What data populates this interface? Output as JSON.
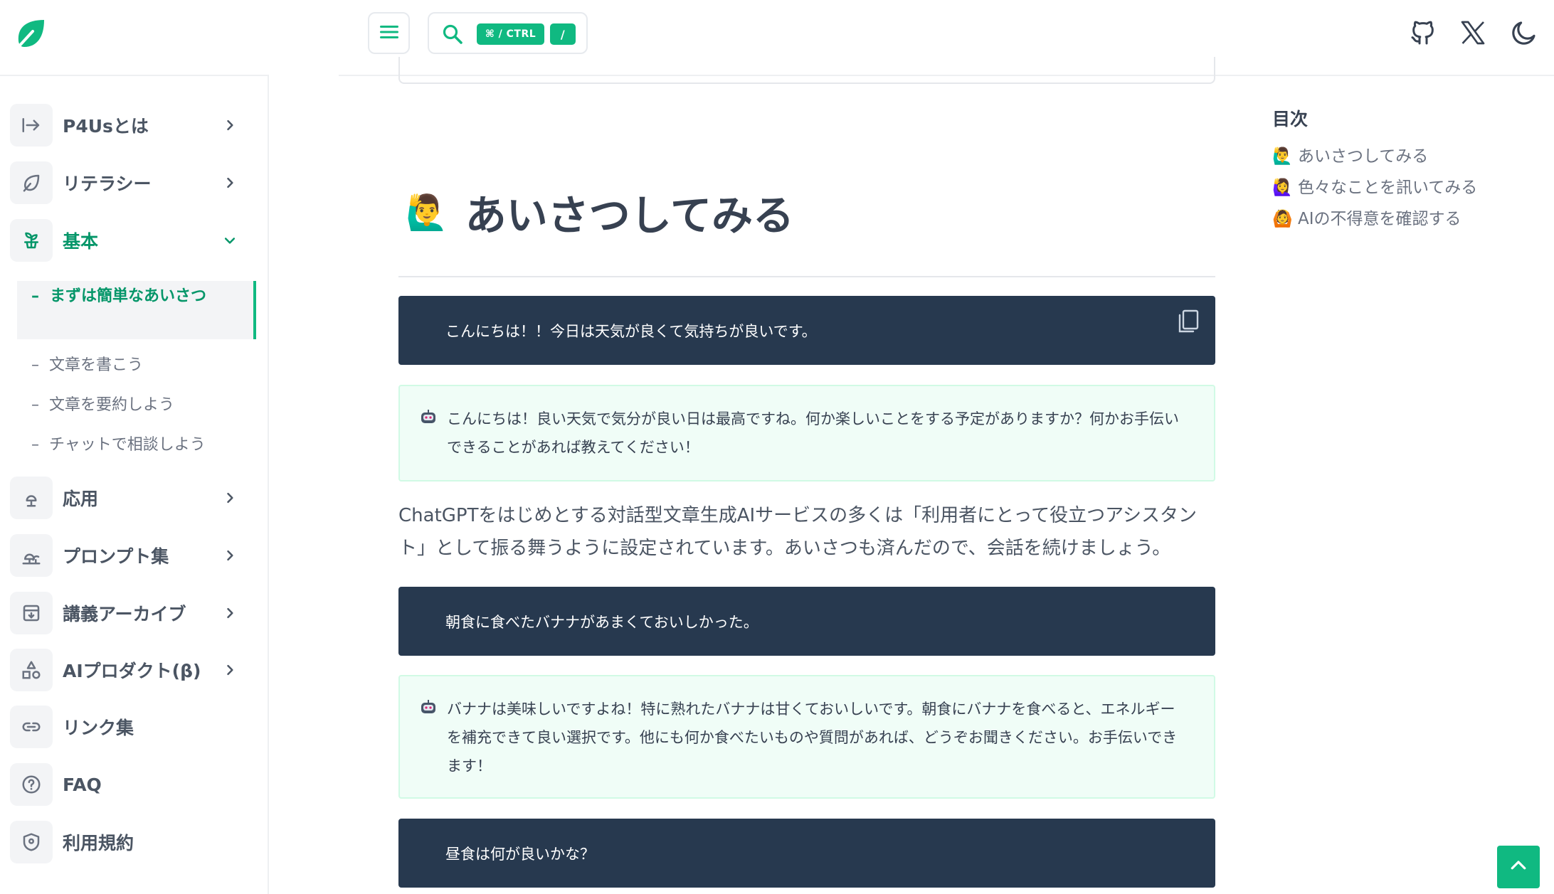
{
  "header": {
    "search_kbd_1": "⌘ / CTRL",
    "search_kbd_2": "/",
    "icons": [
      "leaf-logo-icon",
      "menu-icon",
      "search-icon",
      "github-icon",
      "x-icon",
      "moon-icon"
    ]
  },
  "sidebar": {
    "items": [
      {
        "label": "P4Usとは",
        "icon": "arrow-right-to-line-icon"
      },
      {
        "label": "リテラシー",
        "icon": "leaf-outline-icon"
      },
      {
        "label": "基本",
        "icon": "sprout-icon"
      },
      {
        "label": "応用",
        "icon": "tree-icon"
      },
      {
        "label": "プロンプト集",
        "icon": "trees-icon"
      },
      {
        "label": "講義アーカイブ",
        "icon": "archive-icon"
      },
      {
        "label": "AIプロダクト(β)",
        "icon": "shapes-icon"
      },
      {
        "label": "リンク集",
        "icon": "link-icon"
      },
      {
        "label": "FAQ",
        "icon": "help-circle-icon"
      },
      {
        "label": "利用規約",
        "icon": "shield-icon"
      }
    ],
    "sub_items": [
      {
        "label": "まずは簡単なあいさつ",
        "active": true
      },
      {
        "label": "文章を書こう"
      },
      {
        "label": "文章を要約しよう"
      },
      {
        "label": "チャットで相談しよう"
      }
    ]
  },
  "main": {
    "title_emoji": "🙋‍♂️",
    "title": "あいさつしてみる",
    "prompt_1": "こんにちは！！今日は天気が良くて気持ちが良いです。",
    "reply_1": "こんにちは！良い天気で気分が良い日は最高ですね。何か楽しいことをする予定がありますか？何かお手伝いできることがあれば教えてください！",
    "paragraph": "ChatGPTをはじめとする対話型文章生成AIサービスの多くは「利用者にとって役立つアシスタント」として振る舞うように設定されています。あいさつも済んだので、会話を続けましょう。",
    "prompt_2": "朝食に食べたバナナがあまくておいしかった。",
    "reply_2": "バナナは美味しいですよね！特に熟れたバナナは甘くておいしいです。朝食にバナナを食べると、エネルギーを補充できて良い選択です。他にも何か食べたいものや質問があれば、どうぞお聞きください。お手伝いできます！",
    "prompt_3": "昼食は何が良いかな？"
  },
  "toc": {
    "title": "目次",
    "items": [
      {
        "emoji": "🙋‍♂️",
        "label": "あいさつしてみる"
      },
      {
        "emoji": "🙋‍♀️",
        "label": "色々なことを訊いてみる"
      },
      {
        "emoji": "🙆",
        "label": "AIの不得意を確認する"
      }
    ]
  },
  "colors": {
    "accent": "#10b981",
    "accent_text": "#059669",
    "prompt_bg": "#27394f",
    "reply_bg": "#f0fdf7"
  }
}
